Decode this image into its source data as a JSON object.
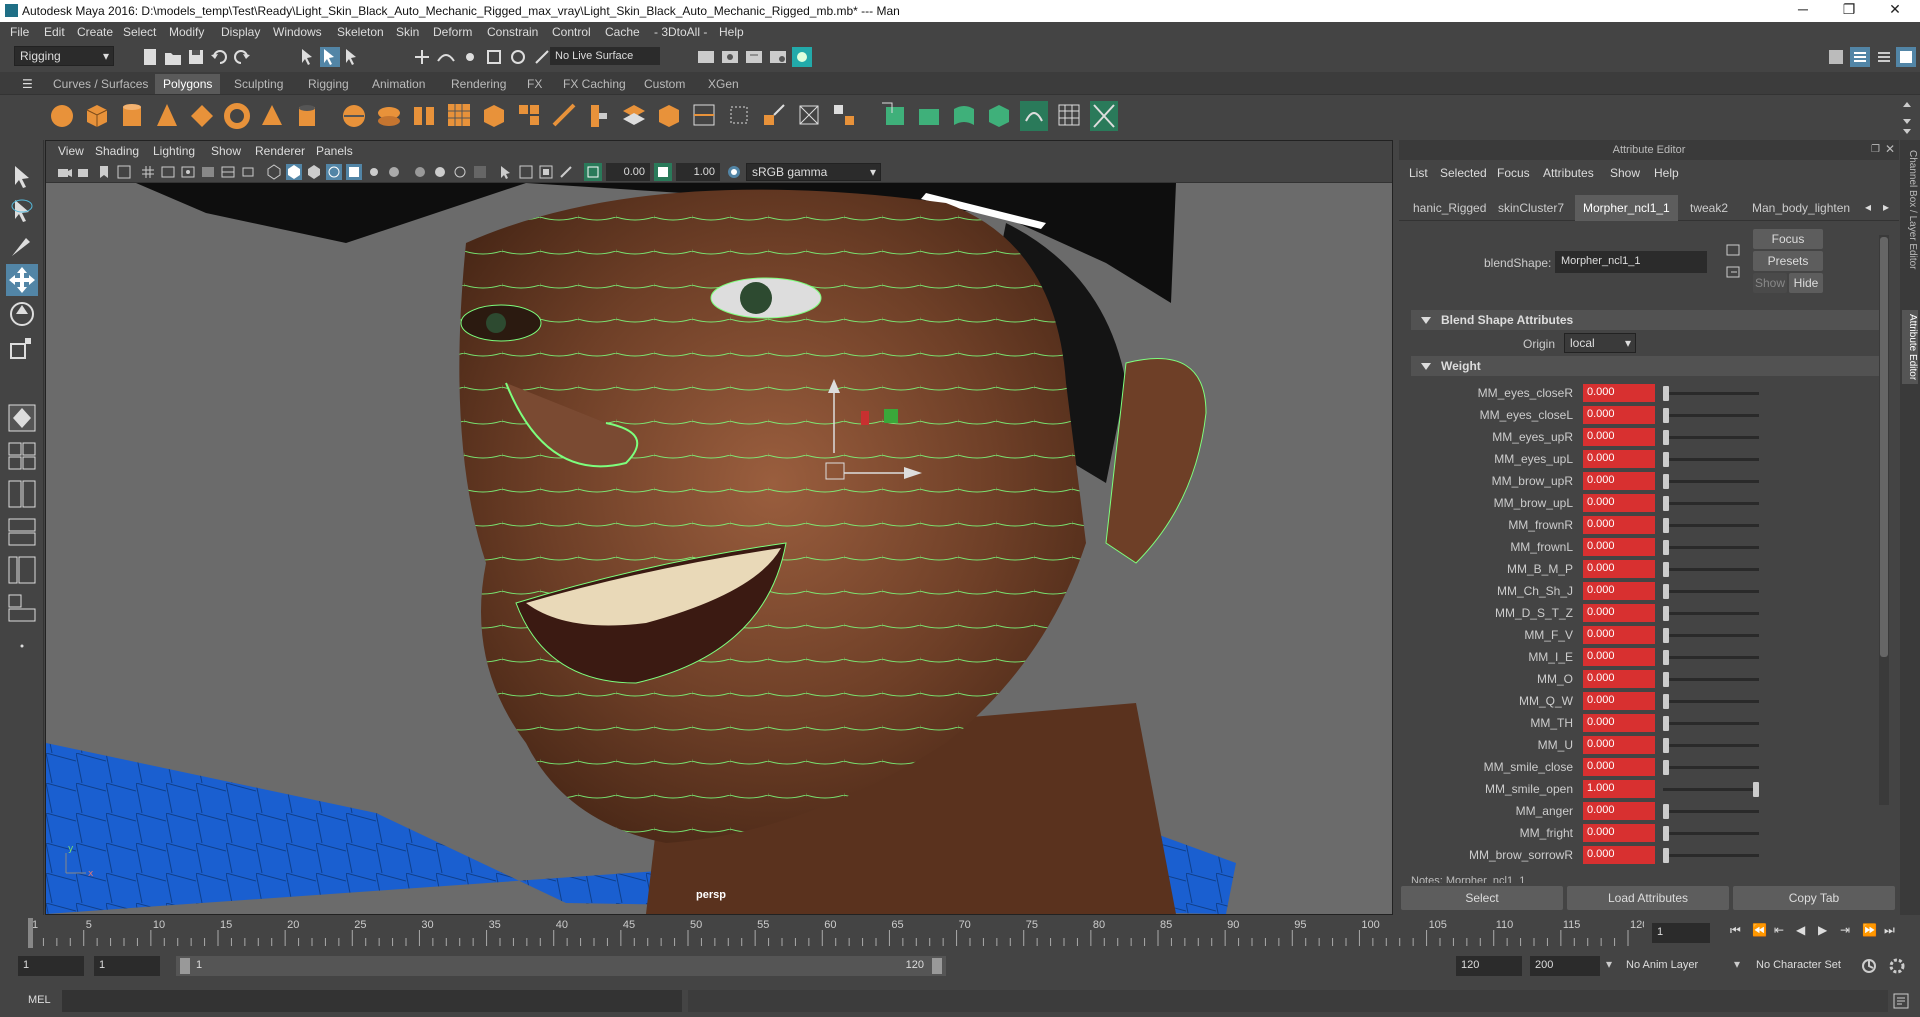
{
  "title_bar": {
    "title": "Autodesk Maya 2016: D:\\models_temp\\Test\\Ready\\Light_Skin_Black_Auto_Mechanic_Rigged_max_vray\\Light_Skin_Black_Auto_Mechanic_Rigged_mb.mb*   ---   Man",
    "minimize": "─",
    "maximize": "❐",
    "close": "✕"
  },
  "menubar": {
    "items": [
      "File",
      "Edit",
      "Create",
      "Select",
      "Modify",
      "Display",
      "Windows",
      "Skeleton",
      "Skin",
      "Deform",
      "Constrain",
      "Control",
      "Cache",
      "- 3DtoAll -",
      "Help"
    ]
  },
  "status_line": {
    "menuset": "Rigging",
    "live_surface": "No Live Surface"
  },
  "shelf": {
    "tabs": [
      "Curves / Surfaces",
      "Polygons",
      "Sculpting",
      "Rigging",
      "Animation",
      "Rendering",
      "FX",
      "FX Caching",
      "Custom",
      "XGen"
    ],
    "active_tab": "Polygons"
  },
  "viewport": {
    "menu": [
      "View",
      "Shading",
      "Lighting",
      "Show",
      "Renderer",
      "Panels"
    ],
    "exposure": "0.00",
    "gamma": "1.00",
    "color_space": "sRGB gamma",
    "camera_label": "persp"
  },
  "attribute_editor": {
    "header": "Attribute Editor",
    "menu": [
      "List",
      "Selected",
      "Focus",
      "Attributes",
      "Show",
      "Help"
    ],
    "tabs": [
      "hanic_Rigged",
      "skinCluster7",
      "Morpher_ncl1_1",
      "tweak2",
      "Man_body_lighten"
    ],
    "active_tab": "Morpher_ncl1_1",
    "blendshape_label": "blendShape:",
    "blendshape_value": "Morpher_ncl1_1",
    "focus_btn": "Focus",
    "presets_btn": "Presets",
    "show_btn": "Show",
    "hide_btn": "Hide",
    "section_blend": "Blend Shape Attributes",
    "origin_label": "Origin",
    "origin_value": "local",
    "section_weight": "Weight",
    "weights": [
      {
        "name": "MM_eyes_closeR",
        "value": "0.000",
        "level": 0
      },
      {
        "name": "MM_eyes_closeL",
        "value": "0.000",
        "level": 0
      },
      {
        "name": "MM_eyes_upR",
        "value": "0.000",
        "level": 0
      },
      {
        "name": "MM_eyes_upL",
        "value": "0.000",
        "level": 0
      },
      {
        "name": "MM_brow_upR",
        "value": "0.000",
        "level": 0
      },
      {
        "name": "MM_brow_upL",
        "value": "0.000",
        "level": 0
      },
      {
        "name": "MM_frownR",
        "value": "0.000",
        "level": 0
      },
      {
        "name": "MM_frownL",
        "value": "0.000",
        "level": 0
      },
      {
        "name": "MM_B_M_P",
        "value": "0.000",
        "level": 0
      },
      {
        "name": "MM_Ch_Sh_J",
        "value": "0.000",
        "level": 0
      },
      {
        "name": "MM_D_S_T_Z",
        "value": "0.000",
        "level": 0
      },
      {
        "name": "MM_F_V",
        "value": "0.000",
        "level": 0
      },
      {
        "name": "MM_I_E",
        "value": "0.000",
        "level": 0
      },
      {
        "name": "MM_O",
        "value": "0.000",
        "level": 0
      },
      {
        "name": "MM_Q_W",
        "value": "0.000",
        "level": 0
      },
      {
        "name": "MM_TH",
        "value": "0.000",
        "level": 0
      },
      {
        "name": "MM_U",
        "value": "0.000",
        "level": 0
      },
      {
        "name": "MM_smile_close",
        "value": "0.000",
        "level": 0
      },
      {
        "name": "MM_smile_open",
        "value": "1.000",
        "level": 1
      },
      {
        "name": "MM_anger",
        "value": "0.000",
        "level": 0
      },
      {
        "name": "MM_fright",
        "value": "0.000",
        "level": 0
      },
      {
        "name": "MM_brow_sorrowR",
        "value": "0.000",
        "level": 0
      }
    ],
    "notes": "Notes: Morpher_ncl1_1",
    "select_btn": "Select",
    "load_btn": "Load Attributes",
    "copy_btn": "Copy Tab"
  },
  "side_tabs": [
    "Channel Box / Layer Editor",
    "Attribute Editor"
  ],
  "time_slider": {
    "ticks": [
      "1",
      "5",
      "10",
      "15",
      "20",
      "25",
      "30",
      "35",
      "40",
      "45",
      "50",
      "55",
      "60",
      "65",
      "70",
      "75",
      "80",
      "85",
      "90",
      "95",
      "100",
      "105",
      "110",
      "115",
      "120"
    ],
    "current_frame": "1"
  },
  "range_slider": {
    "start": "1",
    "playback_start": "1",
    "range_start": "1",
    "range_end": "120",
    "playback_end": "120",
    "end": "200",
    "anim_layer": "No Anim Layer",
    "char_set": "No Character Set"
  },
  "command_line": {
    "label": "MEL"
  },
  "colors": {
    "accent": "#5285a6",
    "weight_field": "#d83030",
    "wire": "#7dff7d",
    "skin": "#7a4a32",
    "shirt": "#1a5fd0"
  }
}
